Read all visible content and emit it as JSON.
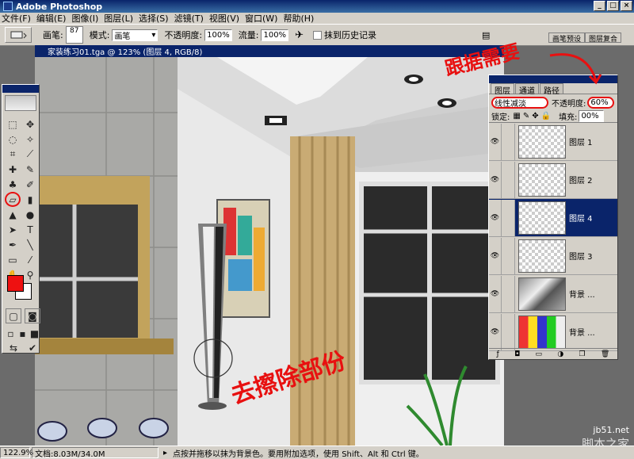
{
  "app": {
    "title": "Adobe Photoshop"
  },
  "window_buttons": [
    "_",
    "□",
    "×"
  ],
  "menu": [
    "文件(F)",
    "编辑(E)",
    "图像(I)",
    "图层(L)",
    "选择(S)",
    "滤镜(T)",
    "视图(V)",
    "窗口(W)",
    "帮助(H)"
  ],
  "options": {
    "brush_label": "画笔:",
    "brush_size": "87",
    "mode_label": "模式:",
    "mode_value": "画笔",
    "opacity_label": "不透明度:",
    "opacity_value": "100%",
    "flow_label": "流量:",
    "flow_value": "100%",
    "erase_history_label": "抹到历史记录"
  },
  "palette_well": {
    "tab1": "画笔预设",
    "tab2": "图层复合"
  },
  "document": {
    "title": "家装练习01.tga @ 123% (图层 4, RGB/8)"
  },
  "layers_panel": {
    "tabs": [
      "图层",
      "通道",
      "路径"
    ],
    "blend_mode": "线性减淡",
    "opacity_label": "不透明度:",
    "opacity_value": "60%",
    "lock_label": "锁定:",
    "fill_label": "填充:",
    "fill_value": "00%",
    "layers": [
      {
        "name": "图层 1",
        "thumb": "transparent"
      },
      {
        "name": "图层 2",
        "thumb": "transparent"
      },
      {
        "name": "图层 4",
        "thumb": "transparent"
      },
      {
        "name": "图层 3",
        "thumb": "transparent"
      },
      {
        "name": "背景 ...",
        "thumb": "photo"
      },
      {
        "name": "背景 ...",
        "thumb": "colorful"
      }
    ]
  },
  "annotations": {
    "top": "跟据需要",
    "bottom": "去擦除部份"
  },
  "status": {
    "zoom": "122.9%",
    "doc_size": "文档:8.03M/34.0M",
    "hint": "点按并拖移以抹为背景色。要用附加选项，使用 Shift、Alt 和 Ctrl 键。"
  },
  "watermark": {
    "site": "jb51.net",
    "name": "脚本之家"
  },
  "colors": {
    "foreground": "#ee1111",
    "background": "#ffffff",
    "accent": "#0a246a"
  }
}
